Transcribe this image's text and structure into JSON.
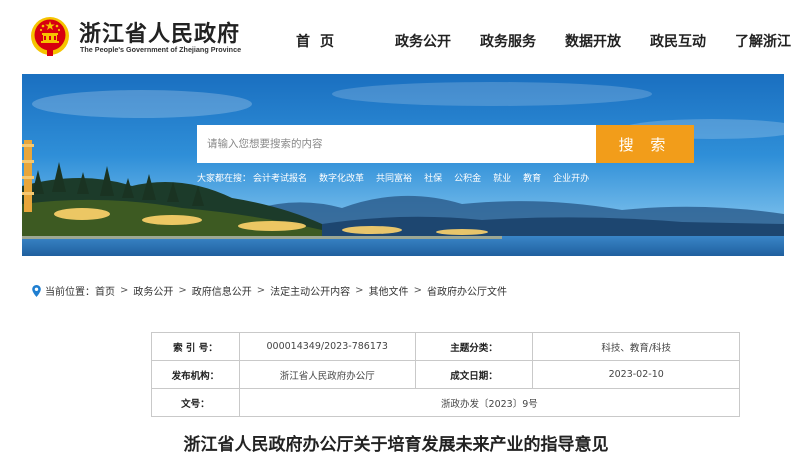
{
  "header": {
    "site_title": "浙江省人民政府",
    "site_subtitle": "The People's Government of Zhejiang Province",
    "nav": [
      "首页",
      "政务公开",
      "政务服务",
      "数据开放",
      "政民互动",
      "了解浙江"
    ]
  },
  "banner": {
    "search_placeholder": "请输入您想要搜索的内容",
    "search_button": "搜 索",
    "hot_label": "大家都在搜：",
    "hot_items": [
      "会计考试报名",
      "数字化改革",
      "共同富裕",
      "社保",
      "公积金",
      "就业",
      "教育",
      "企业开办"
    ]
  },
  "breadcrumb": {
    "label": "当前位置：",
    "items": [
      "首页",
      "政务公开",
      "政府信息公开",
      "法定主动公开内容",
      "其他文件",
      "省政府办公厅文件"
    ],
    "separator": ">"
  },
  "meta": {
    "index_label": "索 引 号：",
    "index_value": "000014349/2023-786173",
    "topic_label": "主题分类：",
    "topic_value": "科技、教育/科技",
    "issuer_label": "发布机构：",
    "issuer_value": "浙江省人民政府办公厅",
    "date_label": "成文日期：",
    "date_value": "2023-02-10",
    "doc_no_label": "文号：",
    "doc_no_value": "浙政办发〔2023〕9号"
  },
  "document": {
    "title": "浙江省人民政府办公厅关于培育发展未来产业的指导意见"
  },
  "colors": {
    "search_button": "#f29d1a",
    "emblem_red": "#d7000f",
    "emblem_gold": "#f5c400"
  }
}
